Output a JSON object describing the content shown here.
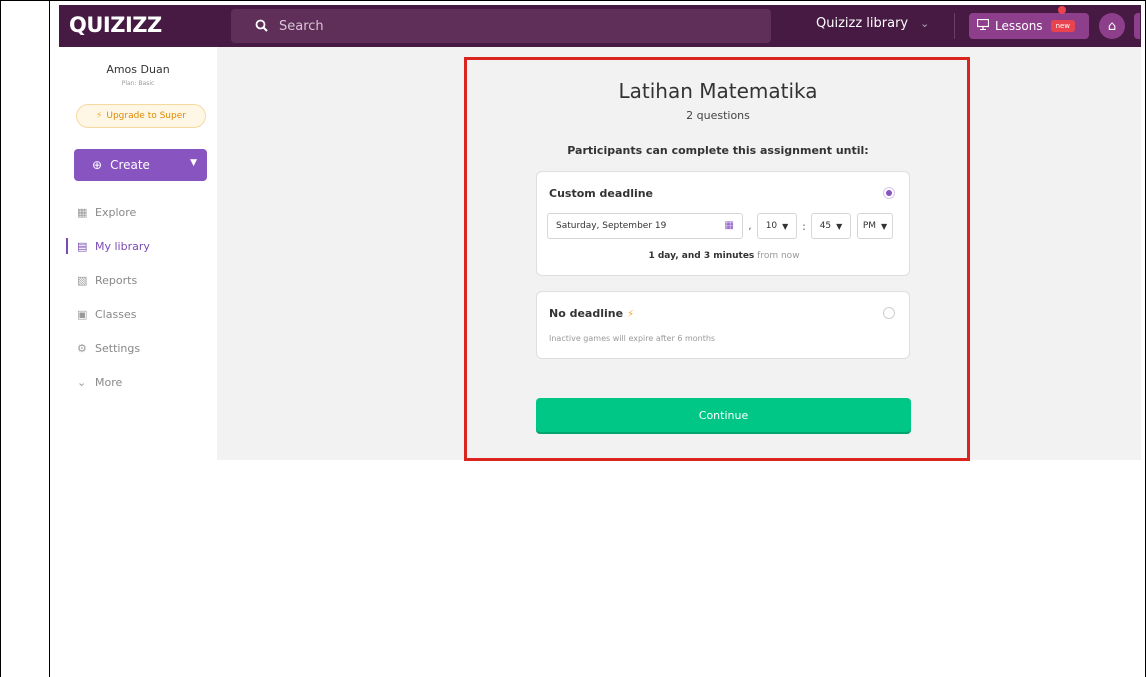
{
  "topbar": {
    "logo": "QUIZIZZ",
    "search_placeholder": "Search",
    "library_select": "Quizizz library",
    "lessons_label": "Lessons",
    "new_badge": "new"
  },
  "sidebar": {
    "user_name": "Amos Duan",
    "user_plan": "Plan: Basic",
    "upgrade_label": "Upgrade to Super",
    "create_label": "Create",
    "nav": [
      {
        "label": "Explore",
        "icon": "explore-icon"
      },
      {
        "label": "My library",
        "icon": "library-icon",
        "active": true
      },
      {
        "label": "Reports",
        "icon": "reports-icon"
      },
      {
        "label": "Classes",
        "icon": "classes-icon"
      },
      {
        "label": "Settings",
        "icon": "settings-icon"
      },
      {
        "label": "More",
        "icon": "chevron-down-icon"
      }
    ]
  },
  "assignment": {
    "title": "Latihan Matematika",
    "question_count": "2 questions",
    "prompt": "Participants can complete this assignment until:",
    "custom": {
      "label": "Custom deadline",
      "date": "Saturday, September 19",
      "hour": "10",
      "minute": "45",
      "ampm": "PM",
      "until_strong": "1 day, and 3 minutes",
      "until_light": "from now"
    },
    "no_deadline": {
      "label": "No deadline",
      "description": "Inactive games will expire after 6 months"
    },
    "continue_label": "Continue"
  },
  "colors": {
    "topbar": "#461a42",
    "primary_purple": "#8854c0",
    "continue_green": "#00c785",
    "highlight_red": "#d9251d"
  }
}
